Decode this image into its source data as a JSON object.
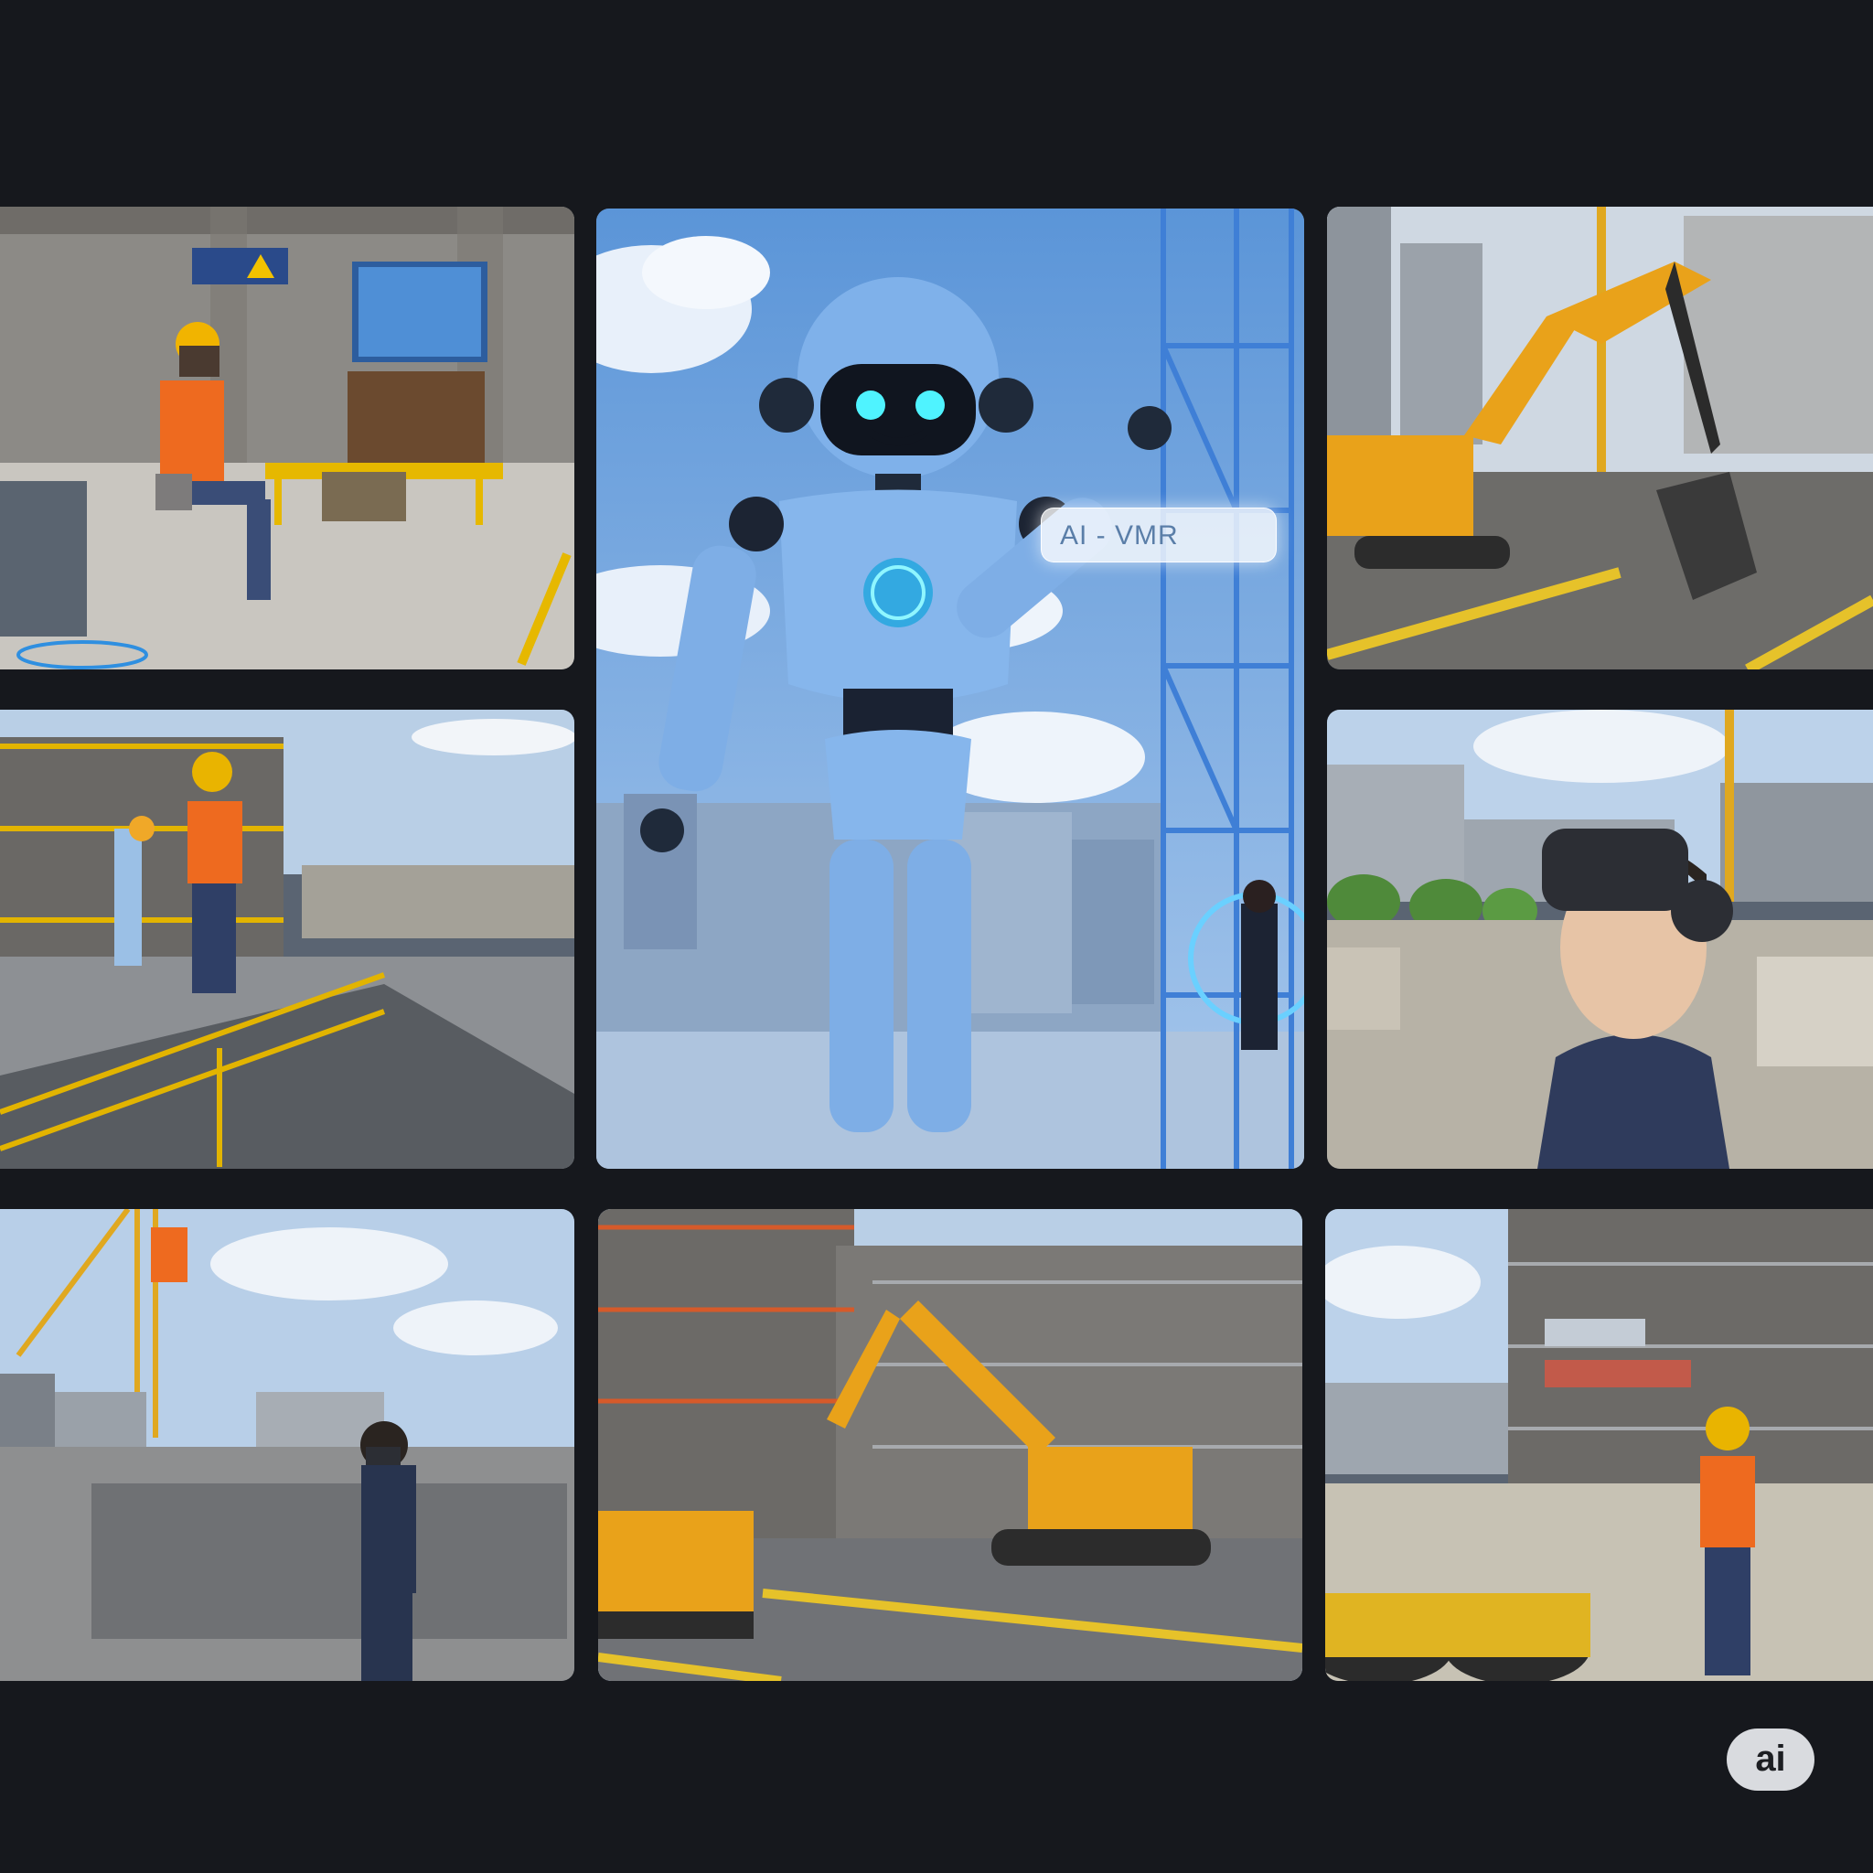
{
  "hero_tile": {
    "label": "AI - VMR"
  },
  "corner_badge": {
    "label": "ai"
  },
  "icons": [
    "warning-sign-icon"
  ]
}
